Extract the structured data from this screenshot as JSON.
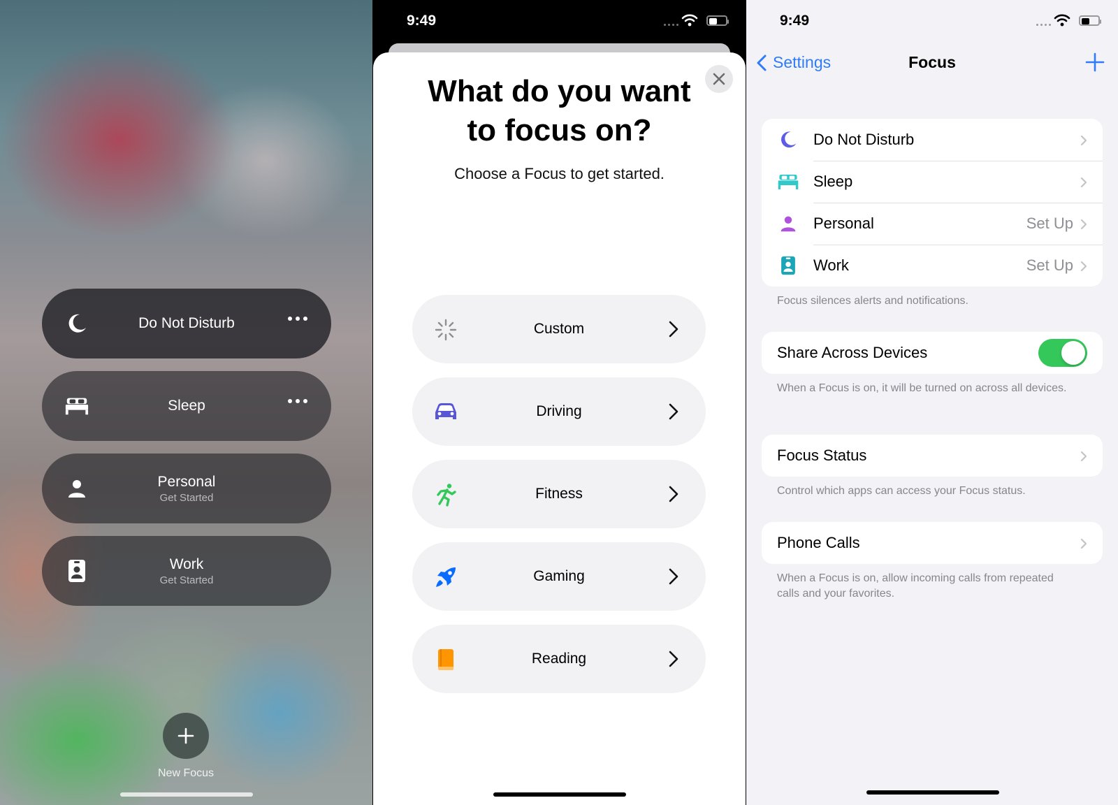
{
  "status_bar": {
    "time": "9:49"
  },
  "control_center": {
    "focus_items": [
      {
        "title": "Do Not Disturb",
        "subtitle": "",
        "icon": "moon-icon",
        "has_more": true,
        "selected": true
      },
      {
        "title": "Sleep",
        "subtitle": "",
        "icon": "bed-icon",
        "has_more": true,
        "selected": false
      },
      {
        "title": "Personal",
        "subtitle": "Get Started",
        "icon": "person-icon",
        "has_more": false,
        "selected": false
      },
      {
        "title": "Work",
        "subtitle": "Get Started",
        "icon": "id-badge-icon",
        "has_more": false,
        "selected": false
      }
    ],
    "new_focus_label": "New Focus"
  },
  "focus_picker": {
    "title_line1": "What do you want",
    "title_line2": "to focus on?",
    "subtitle": "Choose a Focus to get started.",
    "options": [
      {
        "label": "Custom",
        "icon": "sparkle-icon",
        "color": "#8e8e93"
      },
      {
        "label": "Driving",
        "icon": "car-icon",
        "color": "#5856d6"
      },
      {
        "label": "Fitness",
        "icon": "runner-icon",
        "color": "#34c759"
      },
      {
        "label": "Gaming",
        "icon": "rocket-icon",
        "color": "#0a6cff"
      },
      {
        "label": "Reading",
        "icon": "book-icon",
        "color": "#ff9500"
      }
    ]
  },
  "settings": {
    "back_label": "Settings",
    "title": "Focus",
    "focus_list": [
      {
        "label": "Do Not Disturb",
        "value": "",
        "icon": "moon-icon",
        "color": "#5e5ce6"
      },
      {
        "label": "Sleep",
        "value": "",
        "icon": "bed-icon",
        "color": "#30c8c8"
      },
      {
        "label": "Personal",
        "value": "Set Up",
        "icon": "person-icon",
        "color": "#af52de"
      },
      {
        "label": "Work",
        "value": "Set Up",
        "icon": "id-badge-icon",
        "color": "#1aa6b7"
      }
    ],
    "focus_list_footer": "Focus silences alerts and notifications.",
    "share_label": "Share Across Devices",
    "share_enabled": true,
    "share_footer": "When a Focus is on, it will be turned on across all devices.",
    "focus_status_label": "Focus Status",
    "focus_status_footer": "Control which apps can access your Focus status.",
    "phone_calls_label": "Phone Calls",
    "phone_calls_footer": "When a Focus is on, allow incoming calls from repeated calls and your favorites."
  },
  "colors": {
    "accent": "#2f7cf6",
    "toggle_on": "#34c759"
  }
}
